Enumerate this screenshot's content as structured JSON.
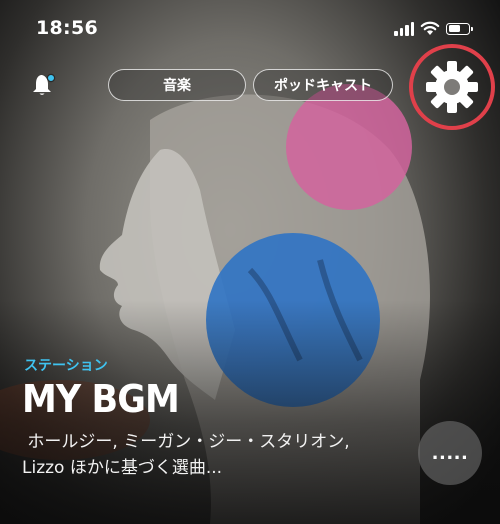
{
  "status_bar": {
    "time": "18:56",
    "icons": [
      "signal-icon",
      "wifi-icon",
      "battery-icon"
    ]
  },
  "top_nav": {
    "notification_icon": "bell-icon",
    "tabs": [
      {
        "label": "音楽"
      },
      {
        "label": "ポッドキャスト"
      }
    ],
    "settings_icon": "gear-icon"
  },
  "hero": {
    "category": "ステーション",
    "title": "MY BGM",
    "description_line1": " ホールジー, ミーガン・ジー・スタリオン,",
    "description_line2": "Lizzo ほかに基づく選曲...",
    "more_label": "....."
  },
  "colors": {
    "accent_blue": "#3fc3f0",
    "notification_dot": "#3fc3f0",
    "highlight_ring": "#e0404a",
    "pink_circle": "#d2649e",
    "blue_circle": "#2f73c4"
  }
}
